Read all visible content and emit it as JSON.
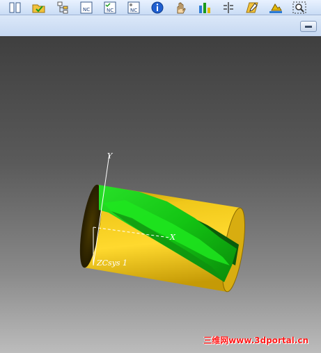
{
  "toolbar": {
    "buttons": [
      {
        "icon": "split-window-icon"
      },
      {
        "icon": "open-folder-check-icon"
      },
      {
        "icon": "operation-tree-icon"
      },
      {
        "icon": "nc-program-icon",
        "label": "NC"
      },
      {
        "icon": "nc-program-check-icon",
        "label": "NC"
      },
      {
        "icon": "nc-program-settings-icon",
        "label": "NC"
      },
      {
        "icon": "info-icon"
      },
      {
        "icon": "hand-tool-icon"
      },
      {
        "icon": "bar-analysis-icon"
      },
      {
        "icon": "section-icon"
      },
      {
        "icon": "edit-note-icon"
      },
      {
        "icon": "blank-stock-icon"
      },
      {
        "icon": "zoom-fit-icon"
      }
    ]
  },
  "viewport": {
    "axes": {
      "y_label": "Y",
      "x_label": "X",
      "csys_label": "ZCsys 1"
    },
    "colors": {
      "cylinder": "#e2b90a",
      "cylinder_dark": "#8a6a00",
      "toolpath": "#1bdc1b",
      "axis": "#ffffff"
    }
  },
  "watermark": "三维网www.3dportal.cn"
}
